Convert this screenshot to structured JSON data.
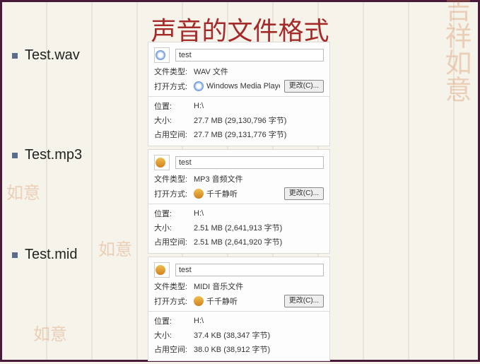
{
  "title": "声音的文件格式",
  "bullets": [
    "Test.wav",
    "Test.mp3",
    "Test.mid"
  ],
  "labels": {
    "fileType": "文件类型:",
    "openWith": "打开方式:",
    "location": "位置:",
    "size": "大小:",
    "diskSize": "占用空间:",
    "change": "更改(C)..."
  },
  "decor": {
    "main": "吉祥如意",
    "stamp": "如意"
  },
  "panels": [
    {
      "icon": "wmp",
      "name": "test",
      "type": "WAV 文件",
      "openIcon": "wmp",
      "openApp": "Windows Media Playe",
      "location": "H:\\",
      "size": "27.7 MB (29,130,796 字节)",
      "disk": "27.7 MB (29,131,776 字节)"
    },
    {
      "icon": "audio",
      "name": "test",
      "type": "MP3 音频文件",
      "openIcon": "audio",
      "openApp": "千千静听",
      "location": "H:\\",
      "size": "2.51 MB (2,641,913 字节)",
      "disk": "2.51 MB (2,641,920 字节)"
    },
    {
      "icon": "audio",
      "name": "test",
      "type": "MIDI 音乐文件",
      "openIcon": "audio",
      "openApp": "千千静听",
      "location": "H:\\",
      "size": "37.4 KB (38,347 字节)",
      "disk": "38.0 KB (38,912 字节)"
    }
  ]
}
